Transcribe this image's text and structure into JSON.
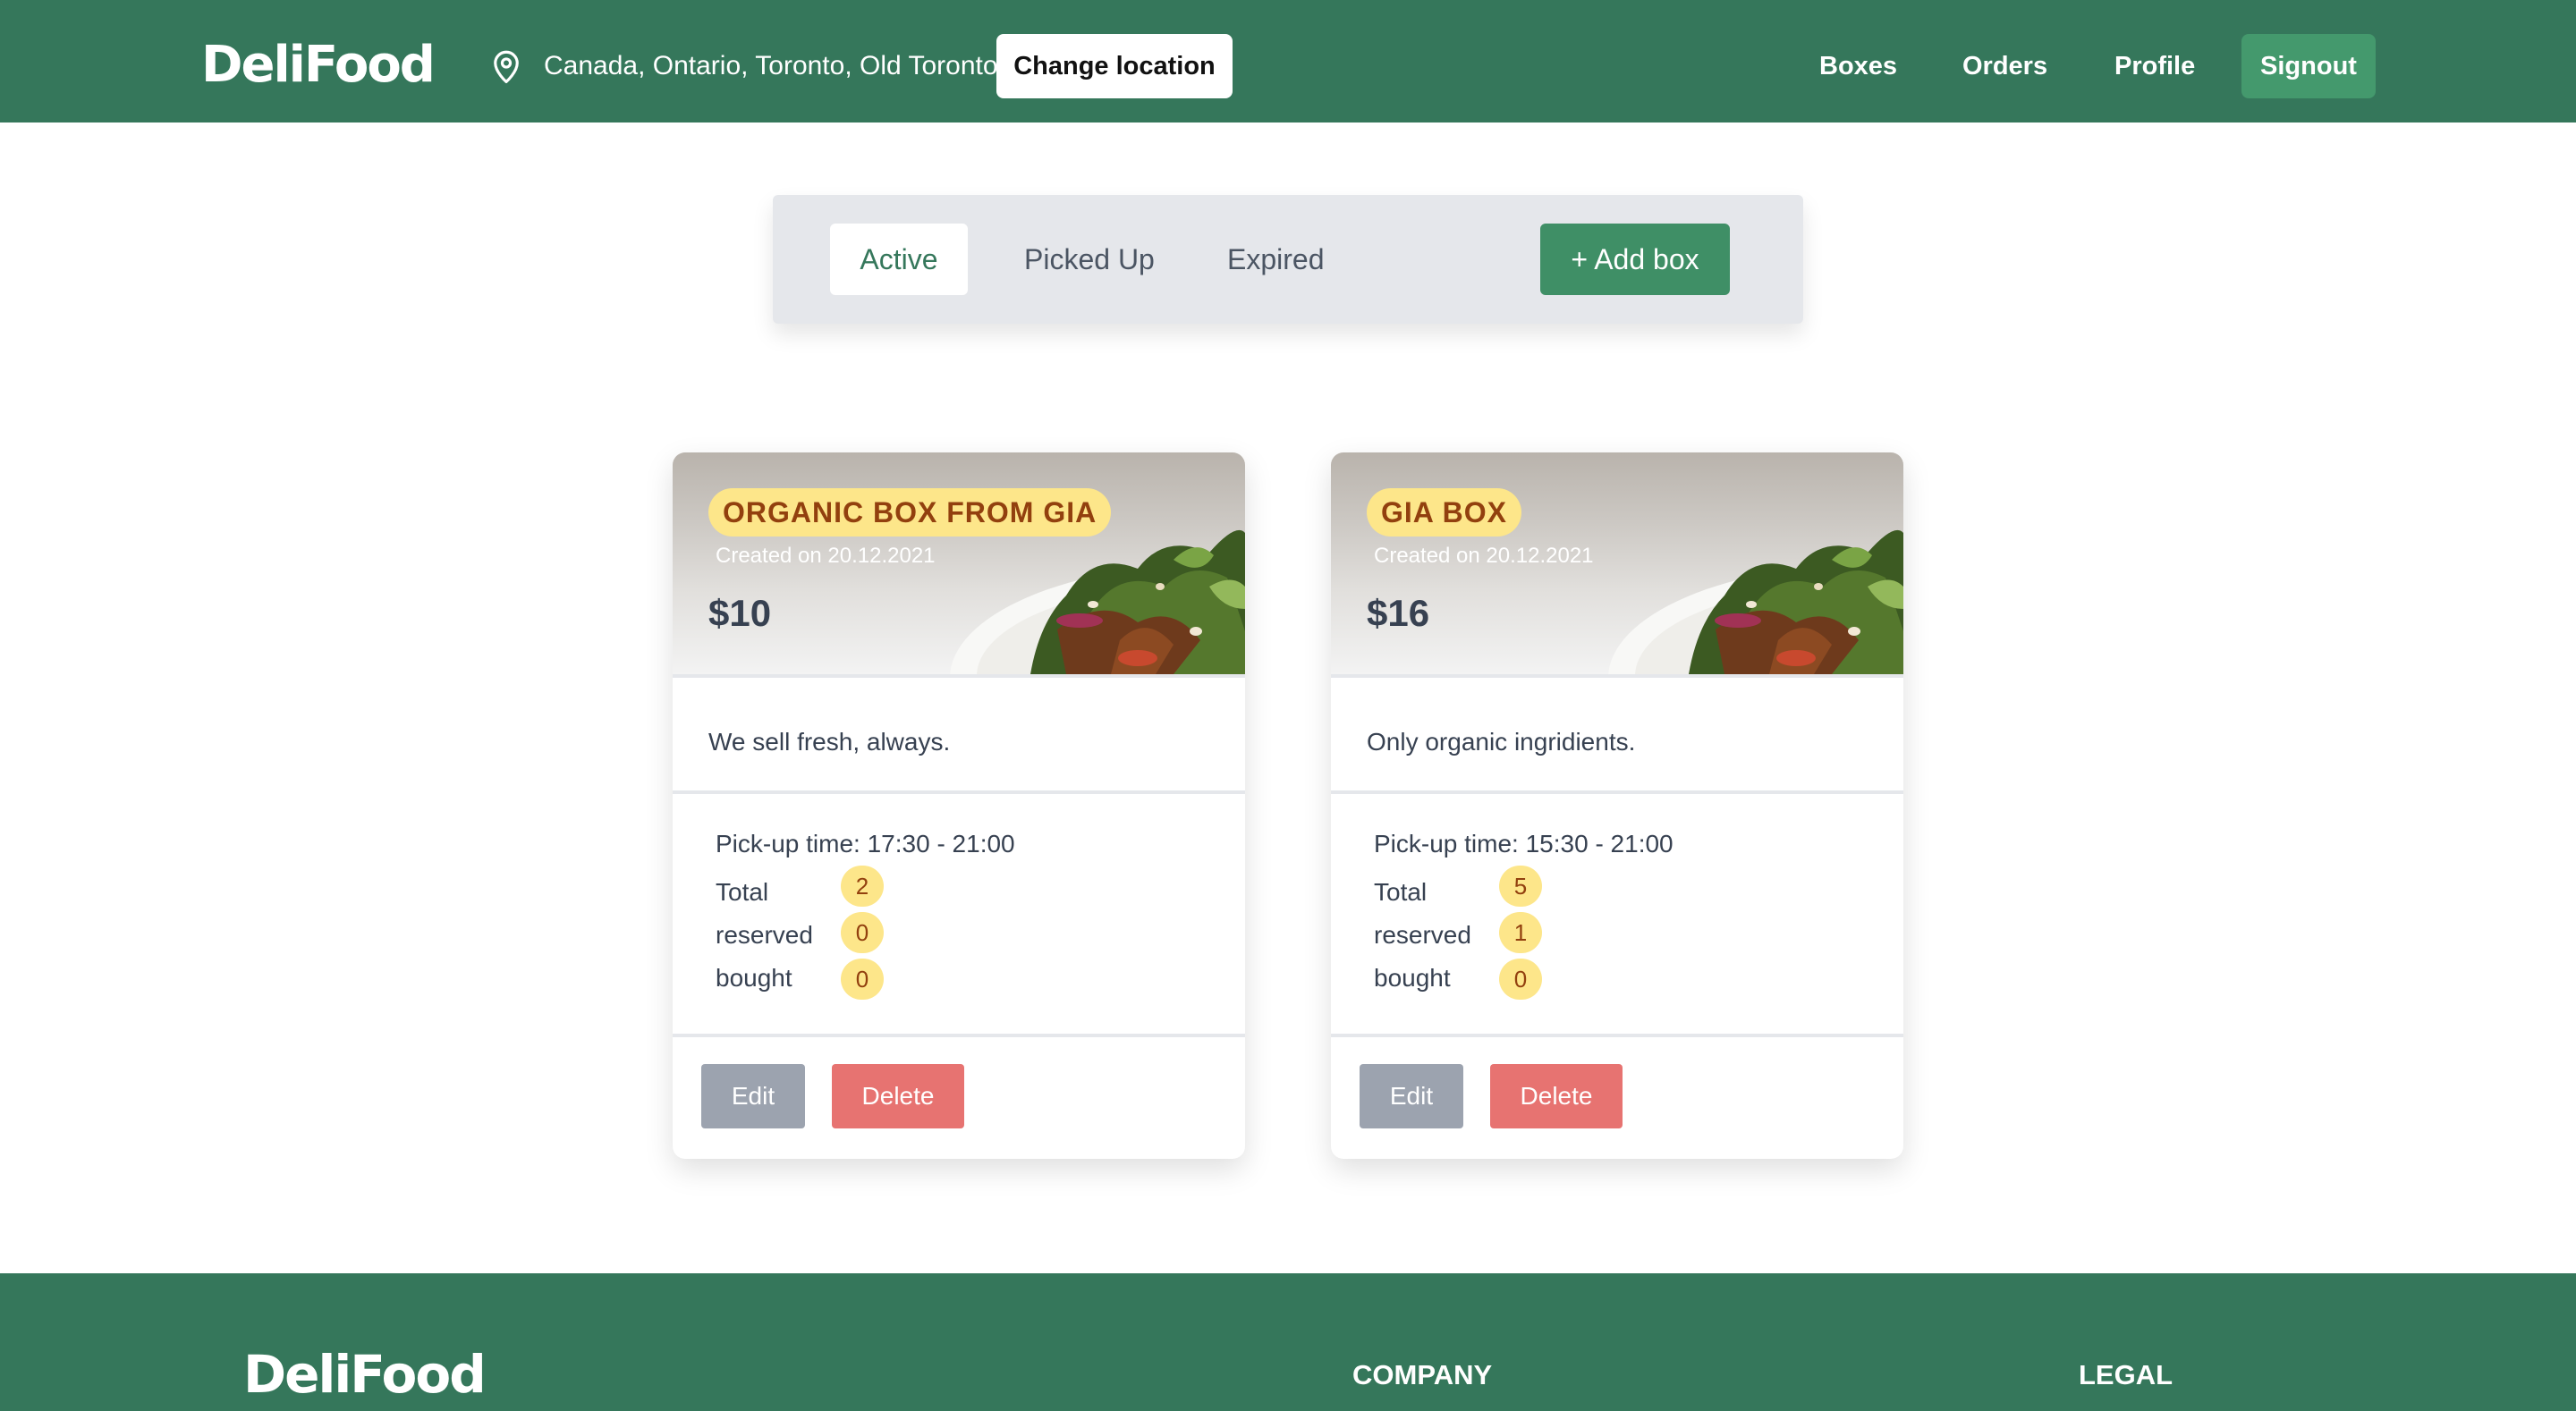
{
  "header": {
    "logo": "DeliFood",
    "location": "Canada, Ontario, Toronto, Old Toronto",
    "change_location": "Change location",
    "nav": {
      "boxes": "Boxes",
      "orders": "Orders",
      "profile": "Profile",
      "signout": "Signout"
    }
  },
  "tabs": {
    "items": [
      {
        "label": "Active",
        "selected": true
      },
      {
        "label": "Picked Up",
        "selected": false
      },
      {
        "label": "Expired",
        "selected": false
      }
    ],
    "add_box": "+ Add box"
  },
  "boxes": [
    {
      "title": "ORGANIC BOX FROM GIA",
      "created": "Created on 20.12.2021",
      "price": "$10",
      "description": "We sell fresh, always.",
      "pickup": "Pick-up time: 17:30 - 21:00",
      "stats": [
        {
          "label": "Total",
          "value": "2"
        },
        {
          "label": "reserved",
          "value": "0"
        },
        {
          "label": "bought",
          "value": "0"
        }
      ],
      "edit": "Edit",
      "delete": "Delete"
    },
    {
      "title": "GIA BOX",
      "created": "Created on 20.12.2021",
      "price": "$16",
      "description": "Only organic ingridients.",
      "pickup": "Pick-up time: 15:30 - 21:00",
      "stats": [
        {
          "label": "Total",
          "value": "5"
        },
        {
          "label": "reserved",
          "value": "1"
        },
        {
          "label": "bought",
          "value": "0"
        }
      ],
      "edit": "Edit",
      "delete": "Delete"
    }
  ],
  "footer": {
    "logo": "DeliFood",
    "company": "COMPANY",
    "legal": "LEGAL"
  },
  "icons": {
    "location": "map-pin-icon",
    "card_image": "salad-plate-image"
  },
  "colors": {
    "brand": "#35775b",
    "accent_button": "#44996d",
    "badge_bg": "#fde68a",
    "badge_text": "#92400e",
    "edit": "#9ca3af",
    "delete": "#e77371"
  }
}
